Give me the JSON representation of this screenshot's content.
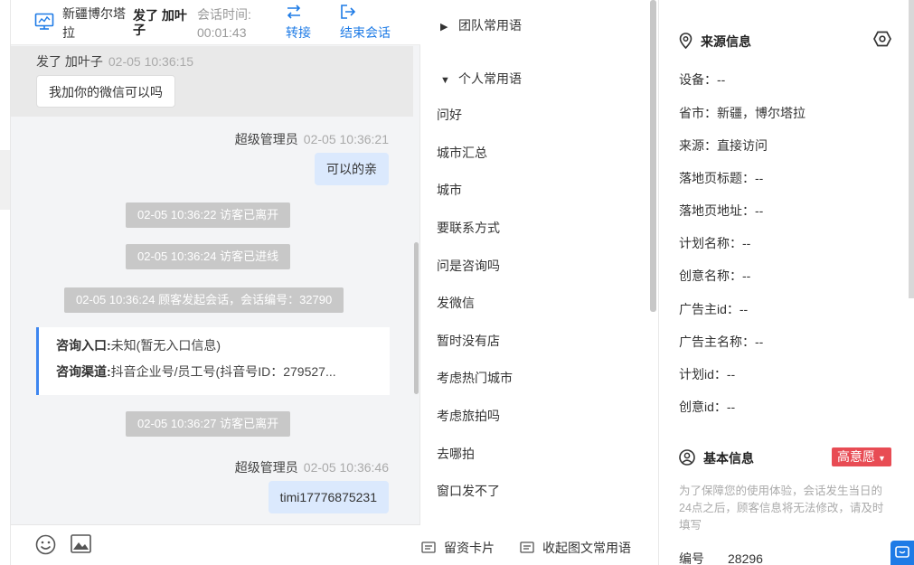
{
  "header": {
    "location": "新疆博尔塔拉",
    "visitor_name": "发了 加叶子",
    "session_time_label": "会话时间:",
    "session_time": "00:01:43",
    "transfer_label": "转接",
    "end_label": "结束会话"
  },
  "messages": {
    "m1_sender": "发了 加叶子",
    "m1_time": "02-05 10:36:15",
    "m1_text": "我加你的微信可以吗",
    "m2_sender": "超级管理员",
    "m2_time": "02-05 10:36:21",
    "m2_text": "可以的亲",
    "sys1": "02-05 10:36:22 访客已离开",
    "sys2": "02-05 10:36:24 访客已进线",
    "sys3": "02-05 10:36:24 顾客发起会话，会话编号：32790",
    "card_entry_label": "咨询入口:",
    "card_entry_value": "未知(暂无入口信息)",
    "card_channel_label": "咨询渠道:",
    "card_channel_value": "抖音企业号/员工号(抖音号ID：279527...",
    "sys4": "02-05 10:36:27 访客已离开",
    "m3_sender": "超级管理员",
    "m3_time": "02-05 10:36:46",
    "m3_text": "timi17776875231"
  },
  "footer": {
    "card_label": "留资卡片",
    "collapse_label": "收起图文常用语"
  },
  "phrases": {
    "team_group": "团队常用语",
    "personal_group": "个人常用语",
    "items": [
      "问好",
      "城市汇总",
      "城市",
      "要联系方式",
      "问是咨询吗",
      "发微信",
      "暂时没有店",
      "考虑热门城市",
      "考虑旅拍吗",
      "去哪拍",
      "窗口发不了"
    ]
  },
  "source_info": {
    "title": "来源信息",
    "fields": [
      "设备：--",
      "省市：新疆，博尔塔拉",
      "来源：直接访问",
      "落地页标题：--",
      "落地页地址：--",
      "计划名称：--",
      "创意名称：--",
      "广告主id：--",
      "广告主名称：--",
      "计划id：--",
      "创意id：--"
    ]
  },
  "basic_info": {
    "title": "基本信息",
    "intent_badge": "高意愿",
    "note": "为了保障您的使用体验，会话发生当日的24点之后，顾客信息将无法修改，请及时填写",
    "id_label": "编号",
    "id_value": "28296"
  },
  "colors": {
    "accent": "#1e7be6",
    "agent_bubble": "#dbe9fd",
    "system_pill": "#c8c8c8",
    "intent_badge": "#e84c54",
    "card_border": "#3d86f0"
  }
}
